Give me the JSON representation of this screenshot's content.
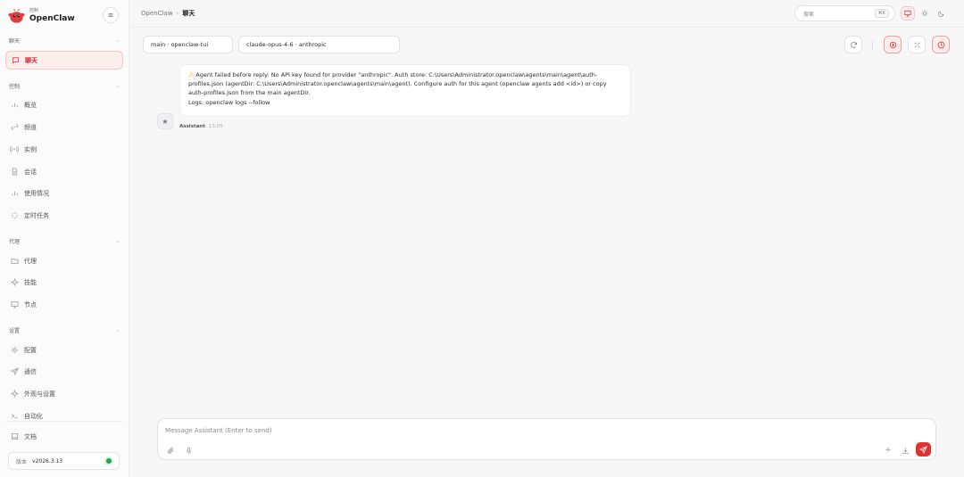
{
  "brand": {
    "subtitle": "控制",
    "name": "OpenClaw"
  },
  "sidebar": {
    "sections": [
      {
        "title": "聊天"
      },
      {
        "title": "控制"
      },
      {
        "title": "代理"
      },
      {
        "title": "设置"
      }
    ],
    "items": {
      "chat": "聊天",
      "overview": "概览",
      "channels": "频道",
      "instances": "实例",
      "sessions": "会话",
      "usage": "使用情况",
      "cron": "定时任务",
      "agents": "代理",
      "skills": "技能",
      "nodes": "节点",
      "config": "配置",
      "comms": "通信",
      "appearance": "外观与设置",
      "automation": "自动化",
      "docs": "文档"
    },
    "version": {
      "label": "版本",
      "value": "v2026.3.13",
      "status_color": "#1fa54a"
    }
  },
  "topbar": {
    "breadcrumb_root": "OpenClaw",
    "breadcrumb_separator": "›",
    "breadcrumb_current": "聊天",
    "search_placeholder": "搜索",
    "search_shortcut": "⌘K"
  },
  "chat": {
    "session_select": "main · openclaw-tui",
    "model_select": "claude-opus-4-6 · anthropic"
  },
  "message": {
    "warning_icon": "⚠",
    "text": "Agent failed before reply: No API key found for provider \"anthropic\". Auth store: C:\\Users\\Administrator.openclaw\\agents\\main\\agent\\auth-profiles.json (agentDir: C:\\Users\\Administrator.openclaw\\agents\\main\\agent). Configure auth for this agent (openclaw agents add <id>) or copy auth-profiles.json from the main agentDir.",
    "logs_line": "Logs: openclaw logs --follow",
    "sender": "Assistant",
    "time": "13:05"
  },
  "composer": {
    "placeholder": "Message Assistant (Enter to send)"
  },
  "colors": {
    "accent": "#d73a3a",
    "send": "#e03232",
    "warning": "#e2a90b"
  }
}
